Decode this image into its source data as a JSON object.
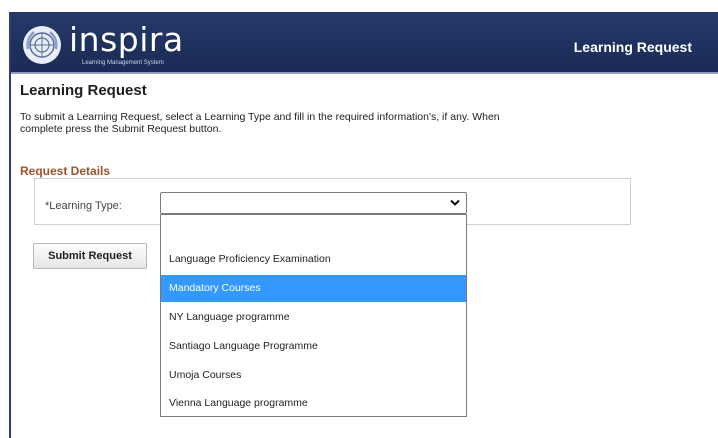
{
  "header": {
    "brand_name": "inspira",
    "brand_tagline": "Learning Management System",
    "title": "Learning Request",
    "logo_icon": "un-emblem-icon"
  },
  "page": {
    "title": "Learning Request",
    "instructions_line1": "To submit a Learning Request, select a Learning Type and fill in the required information's, if any. When",
    "instructions_line2": "complete press the Submit Request button."
  },
  "section": {
    "title": "Request Details",
    "learning_type_label": "*Learning Type:",
    "learning_type_value": "",
    "dropdown_icon": "chevron-down-icon"
  },
  "dropdown": {
    "options": [
      "",
      "Language Proficiency Examination",
      "Mandatory Courses",
      "NY Language programme",
      "Santiago Language Programme",
      "Umoja Courses",
      "Vienna Language programme"
    ],
    "highlighted_index": 2
  },
  "actions": {
    "submit_label": "Submit Request"
  },
  "colors": {
    "header_bg": "#1f3260",
    "section_title": "#a0522d",
    "highlight": "#3399ff"
  }
}
